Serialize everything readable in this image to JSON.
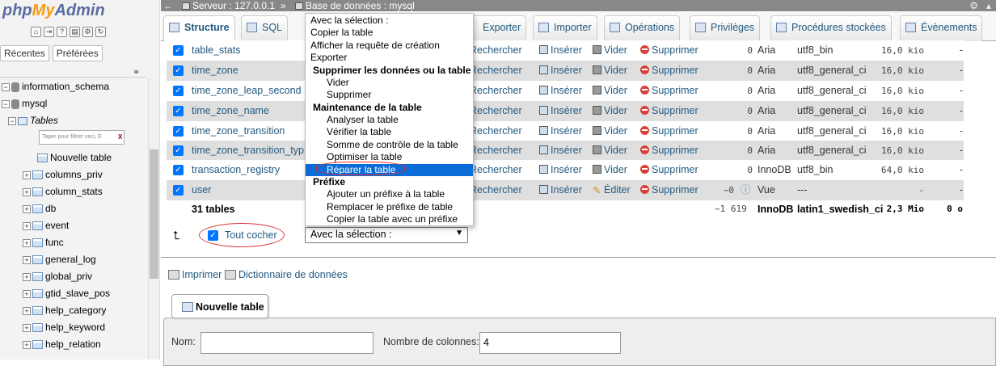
{
  "app": {
    "logo_php": "php",
    "logo_my": "My",
    "logo_admin": "Admin"
  },
  "nav": {
    "recent_btn": "Récentes",
    "favorites_btn": "Préférées",
    "filter_placeholder": "Taper pour filtrer ceci, E",
    "filter_clear": "X",
    "tree": [
      {
        "label": "information_schema",
        "expander": "−"
      },
      {
        "label": "mysql",
        "expander": "−"
      },
      {
        "label": "Tables"
      },
      {
        "label": "Nouvelle table"
      },
      {
        "label": "columns_priv",
        "expander": "+"
      },
      {
        "label": "column_stats",
        "expander": "+"
      },
      {
        "label": "db",
        "expander": "+"
      },
      {
        "label": "event",
        "expander": "+"
      },
      {
        "label": "func",
        "expander": "+"
      },
      {
        "label": "general_log",
        "expander": "+"
      },
      {
        "label": "global_priv",
        "expander": "+"
      },
      {
        "label": "gtid_slave_pos",
        "expander": "+"
      },
      {
        "label": "help_category",
        "expander": "+"
      },
      {
        "label": "help_keyword",
        "expander": "+"
      },
      {
        "label": "help_relation",
        "expander": "+"
      }
    ]
  },
  "topbar": {
    "server": "Serveur : 127.0.0.1",
    "separator": "»",
    "database": "Base de données : mysql"
  },
  "tabs": [
    {
      "label": "Structure"
    },
    {
      "label": "SQL"
    },
    {
      "label": "Exporter"
    },
    {
      "label": "Importer"
    },
    {
      "label": "Opérations"
    },
    {
      "label": "Privilèges"
    },
    {
      "label": "Procédures stockées"
    },
    {
      "label": "Évènements"
    }
  ],
  "actions": {
    "search": "Rechercher",
    "insert": "Insérer",
    "empty": "Vider",
    "delete": "Supprimer",
    "edit": "Éditer"
  },
  "rows": [
    {
      "name": "table_stats",
      "rows": "0",
      "engine": "Aria",
      "collation": "utf8_bin",
      "size": "16,0 kio",
      "overhead": "-"
    },
    {
      "name": "time_zone",
      "rows": "0",
      "engine": "Aria",
      "collation": "utf8_general_ci",
      "size": "16,0 kio",
      "overhead": "-"
    },
    {
      "name": "time_zone_leap_second",
      "rows": "0",
      "engine": "Aria",
      "collation": "utf8_general_ci",
      "size": "16,0 kio",
      "overhead": "-"
    },
    {
      "name": "time_zone_name",
      "rows": "0",
      "engine": "Aria",
      "collation": "utf8_general_ci",
      "size": "16,0 kio",
      "overhead": "-"
    },
    {
      "name": "time_zone_transition",
      "rows": "0",
      "engine": "Aria",
      "collation": "utf8_general_ci",
      "size": "16,0 kio",
      "overhead": "-"
    },
    {
      "name": "time_zone_transition_typ",
      "rows": "0",
      "engine": "Aria",
      "collation": "utf8_general_ci",
      "size": "16,0 kio",
      "overhead": "-"
    },
    {
      "name": "transaction_registry",
      "rows": "0",
      "engine": "InnoDB",
      "collation": "utf8_bin",
      "size": "64,0 kio",
      "overhead": "-"
    },
    {
      "name": "user",
      "rows": "~0",
      "engine": "Vue",
      "collation": "---",
      "size": "-",
      "overhead": "-"
    }
  ],
  "summary": {
    "label": "31 tables",
    "rows": "~1 619",
    "engine": "InnoDB",
    "collation": "latin1_swedish_ci",
    "size": "2,3 Mio",
    "overhead": "0 o"
  },
  "bulk": {
    "check_all": "Tout cocher",
    "select_value": "Avec la sélection :"
  },
  "links": {
    "print": "Imprimer",
    "dictionary": "Dictionnaire de données"
  },
  "new_table": {
    "legend": "Nouvelle table",
    "name_label": "Nom:",
    "columns_label": "Nombre de colonnes:",
    "columns_value": "4"
  },
  "dropdown": {
    "items": [
      {
        "label": "Avec la sélection :",
        "kind": "header"
      },
      {
        "label": "Copier la table",
        "kind": "item"
      },
      {
        "label": "Afficher la requête de création",
        "kind": "item"
      },
      {
        "label": "Exporter",
        "kind": "item"
      },
      {
        "label": "Supprimer les données ou la table",
        "kind": "group"
      },
      {
        "label": "Vider",
        "kind": "sub"
      },
      {
        "label": "Supprimer",
        "kind": "sub"
      },
      {
        "label": "Maintenance de la table",
        "kind": "group"
      },
      {
        "label": "Analyser la table",
        "kind": "sub"
      },
      {
        "label": "Vérifier la table",
        "kind": "sub"
      },
      {
        "label": "Somme de contrôle de la table",
        "kind": "sub"
      },
      {
        "label": "Optimiser la table",
        "kind": "sub"
      },
      {
        "label": "Réparer la table",
        "kind": "selected"
      },
      {
        "label": "Préfixe",
        "kind": "group"
      },
      {
        "label": "Ajouter un préfixe à la table",
        "kind": "sub"
      },
      {
        "label": "Remplacer le préfixe de table",
        "kind": "sub"
      },
      {
        "label": "Copier la table avec un préfixe",
        "kind": "sub"
      }
    ]
  },
  "colors": {
    "link": "#235a81",
    "checkbox": "#0075ff",
    "selected": "#0a6cd6",
    "annotation": "#e03030"
  }
}
